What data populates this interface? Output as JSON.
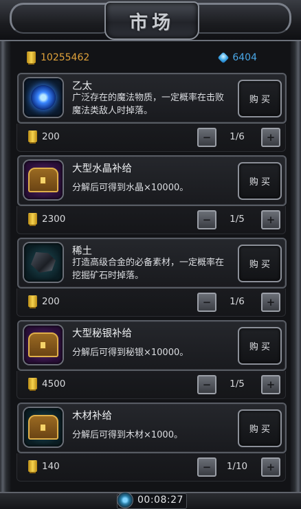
{
  "header": {
    "title": "市场"
  },
  "currency": {
    "gold": "10255462",
    "gems": "6404"
  },
  "items": [
    {
      "name": "乙太",
      "desc": "广泛存在的魔法物质，一定概率在击败魔法类敌人时掉落。",
      "price": "200",
      "quantity": "1/6",
      "buy_label": "购 买",
      "icon": "ether-orb-icon"
    },
    {
      "name": "大型水晶补给",
      "desc": "分解后可得到水晶×10000。",
      "price": "2300",
      "quantity": "1/5",
      "buy_label": "购 买",
      "icon": "treasure-chest-icon"
    },
    {
      "name": "稀土",
      "desc": "打造高级合金的必备素材，一定概率在挖掘矿石时掉落。",
      "price": "200",
      "quantity": "1/6",
      "buy_label": "购 买",
      "icon": "rare-earth-ore-icon"
    },
    {
      "name": "大型秘银补给",
      "desc": "分解后可得到秘银×10000。",
      "price": "4500",
      "quantity": "1/5",
      "buy_label": "购 买",
      "icon": "treasure-chest-icon"
    },
    {
      "name": "木材补给",
      "desc": "分解后可得到木材×1000。",
      "price": "140",
      "quantity": "1/10",
      "buy_label": "购 买",
      "icon": "treasure-chest-icon"
    }
  ],
  "timer": "00:08:27"
}
